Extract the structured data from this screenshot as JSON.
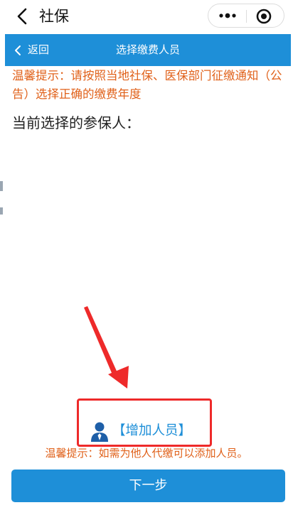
{
  "miniprogram_bar": {
    "title": "社保",
    "back_icon": "chevron-left-icon",
    "more_icon": "more-dots-icon",
    "close_icon": "target-close-icon"
  },
  "page_header": {
    "back_label": "返回",
    "title": "选择缴费人员",
    "background_color": "#1e8fd8"
  },
  "notices": {
    "top": "温馨提示：请按照当地社保、医保部门征缴通知（公告）选择正确的缴费年度",
    "bottom": "温馨提示：如需为他人代缴可以添加人员。",
    "color": "#e0611a"
  },
  "current_selection": {
    "label": "当前选择的参保人："
  },
  "add_person": {
    "label": "【增加人员】",
    "icon": "person-icon",
    "color": "#1e8fd8"
  },
  "annotation": {
    "arrow_color": "#ee2a2a",
    "box_color": "#ee2a2a"
  },
  "next_button": {
    "label": "下一步"
  }
}
